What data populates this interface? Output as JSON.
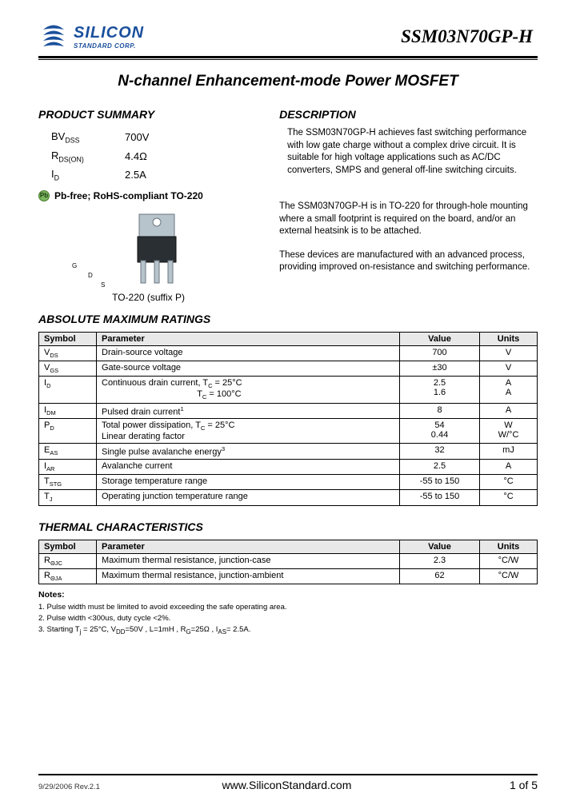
{
  "header": {
    "company_top": "SILICON",
    "company_bottom": "STANDARD CORP.",
    "part_number": "SSM03N70GP-H"
  },
  "title": "N-channel Enhancement-mode Power MOSFET",
  "product_summary": {
    "heading": "PRODUCT SUMMARY",
    "rows": [
      {
        "sym_html": "BV<span class='sub'>DSS</span>",
        "val": "700V"
      },
      {
        "sym_html": "R<span class='sub'>DS(ON)</span>",
        "val": "4.4Ω"
      },
      {
        "sym_html": "I<span class='sub'>D</span>",
        "val": "2.5A"
      }
    ],
    "rohs": "Pb-free; RoHS-compliant TO-220",
    "package_caption": "TO-220 (suffix P)",
    "pins": {
      "g": "G",
      "d": "D",
      "s": "S"
    }
  },
  "description": {
    "heading": "DESCRIPTION",
    "p1": "The SSM03N70GP-H achieves fast switching performance with low gate charge without a complex drive circuit. It is suitable for high voltage applications such as AC/DC converters, SMPS and general off-line switching circuits.",
    "p2": "The SSM03N70GP-H is in TO-220 for through-hole mounting where a small footprint is required on the board, and/or an external heatsink is to be attached.",
    "p3": "These devices are manufactured with an advanced process, providing improved on-resistance and switching performance."
  },
  "abs_max": {
    "heading": "ABSOLUTE MAXIMUM RATINGS",
    "cols": [
      "Symbol",
      "Parameter",
      "Value",
      "Units"
    ],
    "rows": [
      {
        "sym": "V<span class='sub'>DS</span>",
        "param": "Drain-source voltage",
        "val": "700",
        "unit": "V"
      },
      {
        "sym": "V<span class='sub'>GS</span>",
        "param": "Gate-source voltage",
        "val": "±30",
        "unit": "V"
      },
      {
        "sym": "I<span class='sub'>D</span>",
        "param": "Continuous drain current, T<span class='sub'>C</span> = 25°C<br>&nbsp;&nbsp;&nbsp;&nbsp;&nbsp;&nbsp;&nbsp;&nbsp;&nbsp;&nbsp;&nbsp;&nbsp;&nbsp;&nbsp;&nbsp;&nbsp;&nbsp;&nbsp;&nbsp;&nbsp;&nbsp;&nbsp;&nbsp;&nbsp;&nbsp;&nbsp;&nbsp;&nbsp;&nbsp;&nbsp;&nbsp;&nbsp;&nbsp;&nbsp;&nbsp;&nbsp;&nbsp;&nbsp;&nbsp;T<span class='sub'>C</span> = 100°C",
        "val": "2.5<br>1.6",
        "unit": "A<br>A"
      },
      {
        "sym": "I<span class='sub'>DM</span>",
        "param": "Pulsed drain current<sup style='font-size:0.7em'>1</sup>",
        "val": "8",
        "unit": "A"
      },
      {
        "sym": "P<span class='sub'>D</span>",
        "param": "Total power dissipation, T<span class='sub'>C</span> = 25°C<br>Linear derating factor",
        "val": "54<br>0.44",
        "unit": "W<br>W/°C"
      },
      {
        "sym": "E<span class='sub'>AS</span>",
        "param": "Single pulse avalanche energy<sup style='font-size:0.7em'>3</sup>",
        "val": "32",
        "unit": "mJ"
      },
      {
        "sym": "I<span class='sub'>AR</span>",
        "param": "Avalanche current",
        "val": "2.5",
        "unit": "A"
      },
      {
        "sym": "T<span class='sub'>STG</span>",
        "param": "Storage temperature range",
        "val": "-55 to 150",
        "unit": "°C"
      },
      {
        "sym": "T<span class='sub'>J</span>",
        "param": "Operating junction temperature range",
        "val": "-55 to 150",
        "unit": "°C"
      }
    ]
  },
  "thermal": {
    "heading": "THERMAL CHARACTERISTICS",
    "cols": [
      "Symbol",
      "Parameter",
      "Value",
      "Units"
    ],
    "rows": [
      {
        "sym": "R<span class='sub'>ΘJC</span>",
        "param": "Maximum thermal resistance, junction-case",
        "val": "2.3",
        "unit": "°C/W"
      },
      {
        "sym": "R<span class='sub'>ΘJA</span>",
        "param": "Maximum thermal resistance, junction-ambient",
        "val": "62",
        "unit": "°C/W"
      }
    ]
  },
  "notes": {
    "heading": "Notes:",
    "items": [
      "1. Pulse width must be limited to avoid exceeding the safe operating area.",
      "2. Pulse width <300us, duty cycle <2%.",
      "3. Starting T<sub>j</sub> = 25°C, V<sub>DD</sub>=50V , L=1mH , R<sub>G</sub>=25Ω , I<sub>AS</sub>= 2.5A."
    ]
  },
  "footer": {
    "rev": "9/29/2006  Rev.2.1",
    "url": "www.SiliconStandard.com",
    "page": "1 of 5"
  }
}
